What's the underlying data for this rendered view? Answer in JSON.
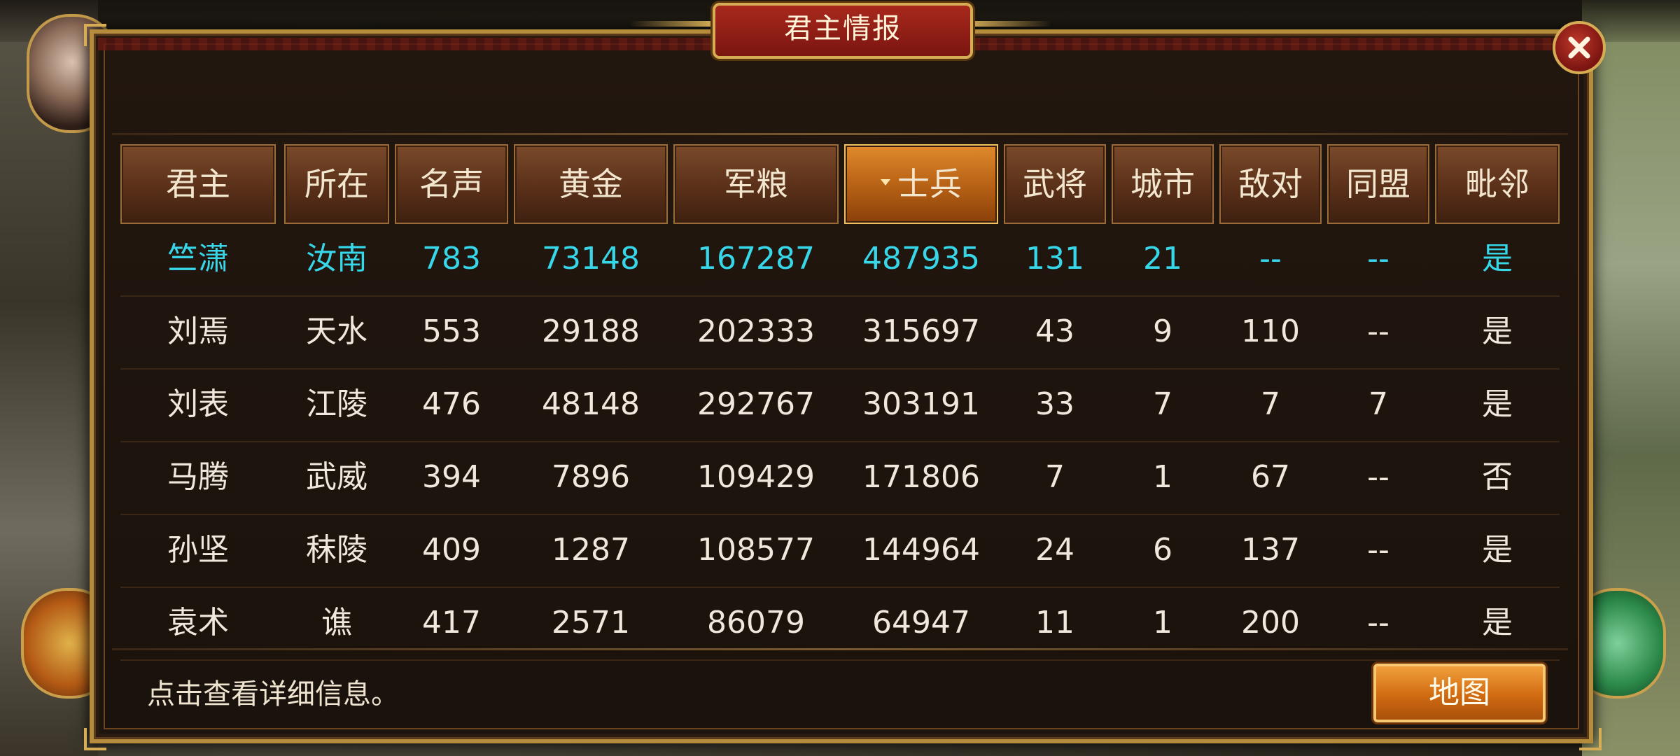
{
  "dialog": {
    "title": "君主情报",
    "hint": "点击查看详细信息。",
    "map_button_label": "地图"
  },
  "table": {
    "columns": [
      "君主",
      "所在",
      "名声",
      "黄金",
      "军粮",
      "士兵",
      "武将",
      "城市",
      "敌对",
      "同盟",
      "毗邻"
    ],
    "sorted_column": "士兵",
    "rows": [
      {
        "c0": "竺潇",
        "c1": "汝南",
        "c2": "783",
        "c3": "73148",
        "c4": "167287",
        "c5": "487935",
        "c6": "131",
        "c7": "21",
        "c8": "--",
        "c9": "--",
        "c10": "是"
      },
      {
        "c0": "刘焉",
        "c1": "天水",
        "c2": "553",
        "c3": "29188",
        "c4": "202333",
        "c5": "315697",
        "c6": "43",
        "c7": "9",
        "c8": "110",
        "c9": "--",
        "c10": "是"
      },
      {
        "c0": "刘表",
        "c1": "江陵",
        "c2": "476",
        "c3": "48148",
        "c4": "292767",
        "c5": "303191",
        "c6": "33",
        "c7": "7",
        "c8": "7",
        "c9": "7",
        "c10": "是"
      },
      {
        "c0": "马腾",
        "c1": "武威",
        "c2": "394",
        "c3": "7896",
        "c4": "109429",
        "c5": "171806",
        "c6": "7",
        "c7": "1",
        "c8": "67",
        "c9": "--",
        "c10": "否"
      },
      {
        "c0": "孙坚",
        "c1": "秣陵",
        "c2": "409",
        "c3": "1287",
        "c4": "108577",
        "c5": "144964",
        "c6": "24",
        "c7": "6",
        "c8": "137",
        "c9": "--",
        "c10": "是"
      },
      {
        "c0": "袁术",
        "c1": "谯",
        "c2": "417",
        "c3": "2571",
        "c4": "86079",
        "c5": "64947",
        "c6": "11",
        "c7": "1",
        "c8": "200",
        "c9": "--",
        "c10": "是"
      }
    ]
  },
  "colors": {
    "highlight_row": "#37d6e8",
    "active_header": "#d07a1c",
    "panel_border": "#b48c3c"
  },
  "icons": {
    "close": "close-icon",
    "sort": "sort-desc-icon"
  }
}
